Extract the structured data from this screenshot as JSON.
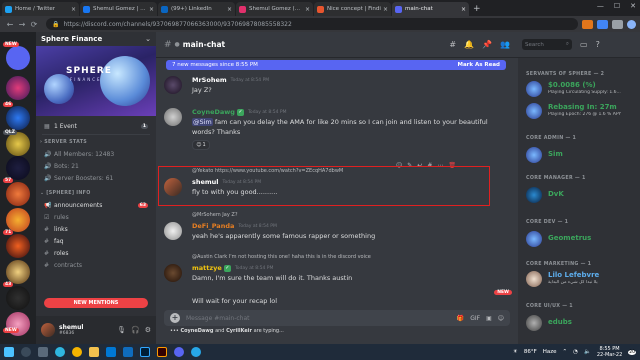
{
  "browser": {
    "tabs": [
      {
        "label": "Home / Twitter",
        "favicon_color": "#1da1f2"
      },
      {
        "label": "Shemul Gomez | Fac",
        "favicon_color": "#1877f2"
      },
      {
        "label": "(99+) LinkedIn",
        "favicon_color": "#0a66c2"
      },
      {
        "label": "Shemul Gomez (@s",
        "favicon_color": "#e1306c"
      },
      {
        "label": "Nice concept | Findi",
        "favicon_color": "#e8552e"
      },
      {
        "label": "main-chat",
        "favicon_color": "#5865f2"
      }
    ],
    "url": "https://discord.com/channels/937069877066363000/937069878085558322"
  },
  "guild_badges": [
    "NEW",
    "46",
    "QLZ",
    "57",
    "71",
    "43",
    "NEW"
  ],
  "server": {
    "name": "Sphere Finance",
    "banner_title": "SPHERE",
    "banner_subtitle": "FINANCE",
    "event": "1 Event",
    "event_count": "1",
    "stats_category": "SERVER STATS",
    "stats": [
      "All Members: 12483",
      "Bots: 21",
      "Server Boosters: 61"
    ],
    "info_category": "[SPHERE] INFO",
    "channels": [
      {
        "label": "announcements",
        "count": "63"
      },
      {
        "label": "rules",
        "count": ""
      },
      {
        "label": "links",
        "count": ""
      },
      {
        "label": "faq",
        "count": ""
      },
      {
        "label": "roles",
        "count": ""
      },
      {
        "label": "contracts",
        "count": ""
      }
    ],
    "new_mentions": "NEW MENTIONS"
  },
  "user": {
    "name": "shemul",
    "tag": "#6836"
  },
  "chat": {
    "channel": "main-chat",
    "new_messages": "7 new messages since 8:55 PM",
    "mark_as_read": "Mark As Read",
    "messages": [
      {
        "name": "MrSohem",
        "time": "Today at 8:54 PM",
        "text": "Jay Z?",
        "name_color": "#ffffff"
      },
      {
        "name": "CoyneDawg",
        "time": "Today at 8:54 PM",
        "mention": "@Sim",
        "text": "fam can you delay the AMA for like 20 mins so I can join and listen to your beautiful words? Thanks",
        "reaction_count": "1",
        "name_color": "#3ba55c"
      },
      {
        "reply": "@Yekato https://www.youtube.com/watch?v=ZEcqHA7dbwM",
        "name": "shemul",
        "time": "Today at 8:54 PM",
        "text": "fly to with you good..........",
        "name_color": "#ffffff"
      },
      {
        "reply": "@MrSohem Jay Z?",
        "name": "DeFi_Panda",
        "time": "Today at 8:54 PM",
        "text": "yeah he's apparently some famous rapper or something",
        "name_color": "#e67e22"
      },
      {
        "reply": "@Austin Clark I'm not hosting this one! haha this is in the discord voice",
        "name": "mattzye",
        "time": "Today at 8:54 PM",
        "text": "Damn, I'm sure the team will do it. Thanks austin",
        "name_color": "#f1c40f"
      },
      {
        "name": "",
        "time": "",
        "text": "Will wait for your recap lol",
        "name_color": "#ffffff"
      }
    ],
    "new_tag": "NEW",
    "composer_placeholder": "Message #main-chat",
    "typing": {
      "users": "CoyneDawg",
      "and": "and",
      "users2": "CyrillKeir",
      "suffix": "are typing..."
    }
  },
  "members": {
    "search_placeholder": "Search",
    "groups": [
      {
        "title": "SERVANTS OF SPHERE — 2",
        "items": [
          {
            "name": "$0.0086 (%)",
            "status": "Playing Circulating Supply: 1.6...",
            "color": "#3ba55c"
          },
          {
            "name": "Rebasing In: 27m",
            "status": "Playing Epoch: 276 @ 1.6 % APY",
            "color": "#3ba55c"
          }
        ]
      },
      {
        "title": "CORE ADMIN — 1",
        "items": [
          {
            "name": "Sim",
            "status": "",
            "color": "#3ba55c"
          }
        ]
      },
      {
        "title": "CORE MANAGER — 1",
        "items": [
          {
            "name": "DvK",
            "status": "",
            "color": "#3ba55c"
          }
        ]
      },
      {
        "title": "CORE DEV — 1",
        "items": [
          {
            "name": "Geometrus",
            "status": "",
            "color": "#3ba55c"
          }
        ]
      },
      {
        "title": "CORE MARKETING — 1",
        "items": [
          {
            "name": "Lilo Lefebvre",
            "status": "يلا نبدأ كل شيء من البداية",
            "color": "#5dadec"
          }
        ]
      },
      {
        "title": "CORE UI/UX — 1",
        "items": [
          {
            "name": "edubs",
            "status": "",
            "color": "#3ba55c"
          }
        ]
      }
    ]
  },
  "taskbar": {
    "weather": "86°F",
    "weather_desc": "Haze",
    "time": "8:55 PM",
    "date": "22-Mar-22",
    "notif": "20"
  }
}
